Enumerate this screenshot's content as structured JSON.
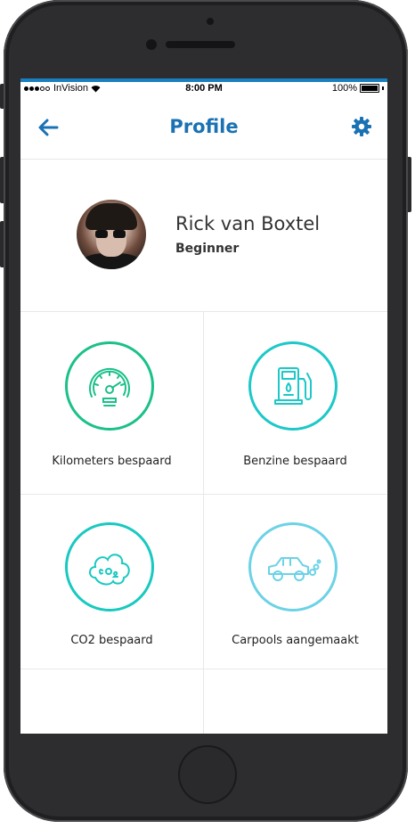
{
  "status_bar": {
    "carrier": "InVision",
    "time": "8:00 PM",
    "battery": "100%"
  },
  "nav": {
    "title": "Profile",
    "back_icon": "arrow-left-icon",
    "settings_icon": "gear-icon"
  },
  "profile": {
    "name": "Rick van Boxtel",
    "level": "Beginner"
  },
  "stats": [
    {
      "label": "Kilometers bespaard",
      "icon": "speedometer-icon",
      "color": "#1bc08a"
    },
    {
      "label": "Benzine bespaard",
      "icon": "fuel-pump-icon",
      "color": "#1cc8c8"
    },
    {
      "label": "CO2 bespaard",
      "icon": "co2-cloud-icon",
      "color": "#18c9c0"
    },
    {
      "label": "Carpools aangemaakt",
      "icon": "car-icon",
      "color": "#6cd2e6"
    }
  ],
  "colors": {
    "accent": "#1a72b3",
    "status_bar_line": "#1a7fbf",
    "divider": "#e8e8e8"
  }
}
